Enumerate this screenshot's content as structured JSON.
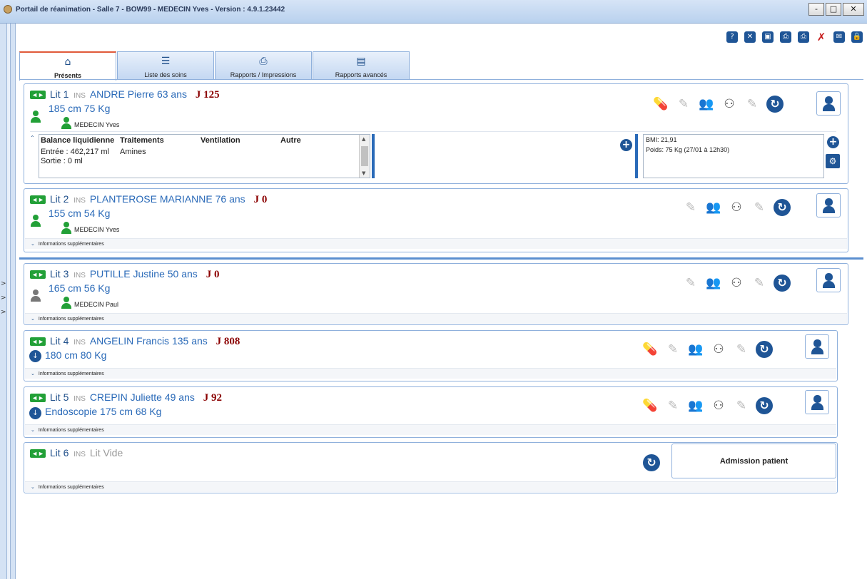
{
  "window": {
    "title": "Portail de réanimation - Salle 7 - BOW99 - MEDECIN Yves - Version : 4.9.1.23442",
    "minimize": "-",
    "maximize": "□",
    "close": "✕"
  },
  "toolbar_icons": [
    "help-icon",
    "close-window-icon",
    "screen-icon",
    "print-label-icon",
    "print-patient-icon",
    "no-pen-icon",
    "mail-icon",
    "lock-icon"
  ],
  "tabs": [
    {
      "label": "Présents",
      "icon": "home-icon",
      "active": true
    },
    {
      "label": "Liste des soins",
      "icon": "care-list-icon",
      "active": false
    },
    {
      "label": "Rapports / Impressions",
      "icon": "printer-icon",
      "active": false
    },
    {
      "label": "Rapports avancés",
      "icon": "document-icon",
      "active": false
    }
  ],
  "common": {
    "bed_tag": "◄►",
    "ins": "INS",
    "infos_label": "Informations supplémentaires",
    "vpa": "VPA",
    "sspi": "sspi"
  },
  "beds": [
    {
      "lit": "Lit 1",
      "patient": "ANDRE Pierre 63 ans",
      "j": "J 125",
      "measures": "185 cm 75 Kg",
      "doctor": "MEDECIN Yves",
      "detail": {
        "headers": [
          "Balance liquidienne",
          "Traitements",
          "Ventilation",
          "Autre"
        ],
        "entree": "Entrée : 462,217 ml",
        "amines": "Amines",
        "sortie": "Sortie : 0 ml",
        "bmi": "BMI: 21,91",
        "poids": "Poids: 75 Kg (27/01 à 12h30)"
      }
    },
    {
      "lit": "Lit 2",
      "patient": "PLANTEROSE MARIANNE 76 ans",
      "j": "J 0",
      "measures": "155 cm 54 Kg",
      "doctor": "MEDECIN Yves"
    },
    {
      "lit": "Lit 3",
      "patient": "PUTILLE Justine 50 ans",
      "j": "J 0",
      "measures": "165 cm 56 Kg",
      "doctor": "MEDECIN Paul"
    },
    {
      "lit": "Lit 4",
      "patient": "ANGELIN Francis 135 ans",
      "j": "J 808",
      "measures": "180 cm 80 Kg"
    },
    {
      "lit": "Lit 5",
      "patient": "CREPIN Juliette 49 ans",
      "j": "J 92",
      "measures": "Endoscopie 175 cm 68 Kg"
    },
    {
      "lit": "Lit 6",
      "patient": "Lit Vide",
      "admission": "Admission patient"
    }
  ],
  "side_arrows": [
    ">",
    ">",
    ">"
  ]
}
